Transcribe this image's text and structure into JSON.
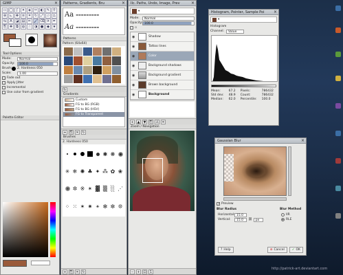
{
  "toolbox": {
    "title": "GIMP",
    "tool_options_title": "Tool Options",
    "mode_label": "Mode:",
    "mode_value": "Normal",
    "opacity_label": "Opacity:",
    "opacity_value": "100.0",
    "brush_label": "Brush:",
    "brush_value": "2. Hardness 050",
    "scale_label": "Scale:",
    "scale_value": "1.00",
    "fade_label": "Fade out",
    "jitter_label": "Apply Jitter",
    "incremental_label": "Incremental",
    "grad_label": "Use color from gradient",
    "palette_title": "Palette Editor",
    "fg_color": "#9a5a3a",
    "bg_color": "#ffffff"
  },
  "patterns": {
    "title": "Patterns, Gradients, Bru",
    "tab_title": "Patterns",
    "caption": "Pattern (64x64)",
    "gradients_title": "Gradients",
    "gradients": [
      "Custom",
      "FG to BG (RGB)",
      "FG to BG (HSV)",
      "FG to Transparent"
    ],
    "brushes_title": "Brushes",
    "brush_caption": "2. Hardness 050"
  },
  "layers": {
    "title": "Ilc. Paths, Undo, Image, Prev",
    "mode_label": "Mode:",
    "mode_value": "Normal",
    "opacity_label": "Opacity:",
    "opacity_value": "100.0",
    "items": [
      {
        "label": "Shadow"
      },
      {
        "label": "Tattoo lines"
      },
      {
        "label": "Color"
      },
      {
        "label": "Background shadows"
      },
      {
        "label": "Background gradient"
      },
      {
        "label": "Brown background"
      },
      {
        "label": "Background"
      }
    ],
    "nav_title": "Zoom / Navigation"
  },
  "histogram": {
    "title": "Histogram, Pointer, Sample Poi",
    "tab": "Histogram",
    "channel_label": "Channel:",
    "channel_value": "Value",
    "stats": {
      "mean_label": "Mean:",
      "mean_value": "67.2",
      "std_label": "Std dev:",
      "std_value": "48.9",
      "median_label": "Median:",
      "median_value": "62.0",
      "pixels_label": "Pixels:",
      "pixels_value": "786432",
      "count_label": "Count:",
      "count_value": "786432",
      "pct_label": "Percentile:",
      "pct_value": "100.0"
    }
  },
  "gaussian": {
    "title": "Gaussian Blur",
    "preview_label": "Preview",
    "radius_title": "Blur Radius",
    "horizontal_label": "Horizontal:",
    "horizontal_value": "15.0",
    "vertical_label": "Vertical:",
    "vertical_value": "15.0",
    "unit": "px",
    "method_title": "Blur Method",
    "method_iir": "IIR",
    "method_rle": "RLE",
    "help_label": "Help",
    "cancel_label": "Cancel",
    "ok_label": "OK"
  },
  "footer": {
    "credit": "http://patrick-art.deviantart.com"
  }
}
